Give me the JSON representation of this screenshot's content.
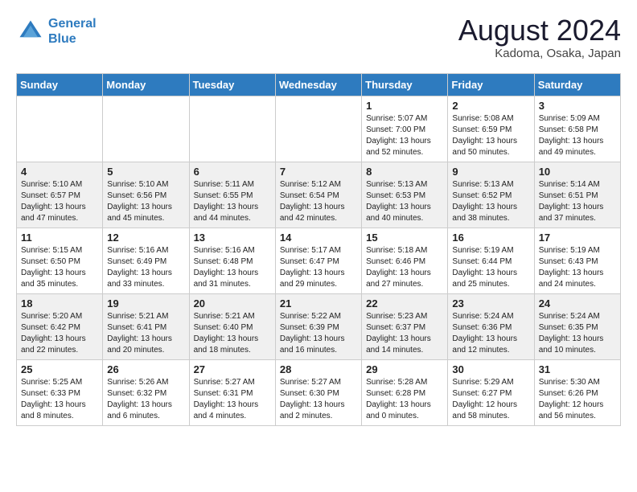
{
  "header": {
    "logo_line1": "General",
    "logo_line2": "Blue",
    "month_title": "August 2024",
    "location": "Kadoma, Osaka, Japan"
  },
  "weekdays": [
    "Sunday",
    "Monday",
    "Tuesday",
    "Wednesday",
    "Thursday",
    "Friday",
    "Saturday"
  ],
  "weeks": [
    [
      {
        "day": "",
        "info": ""
      },
      {
        "day": "",
        "info": ""
      },
      {
        "day": "",
        "info": ""
      },
      {
        "day": "",
        "info": ""
      },
      {
        "day": "1",
        "info": "Sunrise: 5:07 AM\nSunset: 7:00 PM\nDaylight: 13 hours\nand 52 minutes."
      },
      {
        "day": "2",
        "info": "Sunrise: 5:08 AM\nSunset: 6:59 PM\nDaylight: 13 hours\nand 50 minutes."
      },
      {
        "day": "3",
        "info": "Sunrise: 5:09 AM\nSunset: 6:58 PM\nDaylight: 13 hours\nand 49 minutes."
      }
    ],
    [
      {
        "day": "4",
        "info": "Sunrise: 5:10 AM\nSunset: 6:57 PM\nDaylight: 13 hours\nand 47 minutes."
      },
      {
        "day": "5",
        "info": "Sunrise: 5:10 AM\nSunset: 6:56 PM\nDaylight: 13 hours\nand 45 minutes."
      },
      {
        "day": "6",
        "info": "Sunrise: 5:11 AM\nSunset: 6:55 PM\nDaylight: 13 hours\nand 44 minutes."
      },
      {
        "day": "7",
        "info": "Sunrise: 5:12 AM\nSunset: 6:54 PM\nDaylight: 13 hours\nand 42 minutes."
      },
      {
        "day": "8",
        "info": "Sunrise: 5:13 AM\nSunset: 6:53 PM\nDaylight: 13 hours\nand 40 minutes."
      },
      {
        "day": "9",
        "info": "Sunrise: 5:13 AM\nSunset: 6:52 PM\nDaylight: 13 hours\nand 38 minutes."
      },
      {
        "day": "10",
        "info": "Sunrise: 5:14 AM\nSunset: 6:51 PM\nDaylight: 13 hours\nand 37 minutes."
      }
    ],
    [
      {
        "day": "11",
        "info": "Sunrise: 5:15 AM\nSunset: 6:50 PM\nDaylight: 13 hours\nand 35 minutes."
      },
      {
        "day": "12",
        "info": "Sunrise: 5:16 AM\nSunset: 6:49 PM\nDaylight: 13 hours\nand 33 minutes."
      },
      {
        "day": "13",
        "info": "Sunrise: 5:16 AM\nSunset: 6:48 PM\nDaylight: 13 hours\nand 31 minutes."
      },
      {
        "day": "14",
        "info": "Sunrise: 5:17 AM\nSunset: 6:47 PM\nDaylight: 13 hours\nand 29 minutes."
      },
      {
        "day": "15",
        "info": "Sunrise: 5:18 AM\nSunset: 6:46 PM\nDaylight: 13 hours\nand 27 minutes."
      },
      {
        "day": "16",
        "info": "Sunrise: 5:19 AM\nSunset: 6:44 PM\nDaylight: 13 hours\nand 25 minutes."
      },
      {
        "day": "17",
        "info": "Sunrise: 5:19 AM\nSunset: 6:43 PM\nDaylight: 13 hours\nand 24 minutes."
      }
    ],
    [
      {
        "day": "18",
        "info": "Sunrise: 5:20 AM\nSunset: 6:42 PM\nDaylight: 13 hours\nand 22 minutes."
      },
      {
        "day": "19",
        "info": "Sunrise: 5:21 AM\nSunset: 6:41 PM\nDaylight: 13 hours\nand 20 minutes."
      },
      {
        "day": "20",
        "info": "Sunrise: 5:21 AM\nSunset: 6:40 PM\nDaylight: 13 hours\nand 18 minutes."
      },
      {
        "day": "21",
        "info": "Sunrise: 5:22 AM\nSunset: 6:39 PM\nDaylight: 13 hours\nand 16 minutes."
      },
      {
        "day": "22",
        "info": "Sunrise: 5:23 AM\nSunset: 6:37 PM\nDaylight: 13 hours\nand 14 minutes."
      },
      {
        "day": "23",
        "info": "Sunrise: 5:24 AM\nSunset: 6:36 PM\nDaylight: 13 hours\nand 12 minutes."
      },
      {
        "day": "24",
        "info": "Sunrise: 5:24 AM\nSunset: 6:35 PM\nDaylight: 13 hours\nand 10 minutes."
      }
    ],
    [
      {
        "day": "25",
        "info": "Sunrise: 5:25 AM\nSunset: 6:33 PM\nDaylight: 13 hours\nand 8 minutes."
      },
      {
        "day": "26",
        "info": "Sunrise: 5:26 AM\nSunset: 6:32 PM\nDaylight: 13 hours\nand 6 minutes."
      },
      {
        "day": "27",
        "info": "Sunrise: 5:27 AM\nSunset: 6:31 PM\nDaylight: 13 hours\nand 4 minutes."
      },
      {
        "day": "28",
        "info": "Sunrise: 5:27 AM\nSunset: 6:30 PM\nDaylight: 13 hours\nand 2 minutes."
      },
      {
        "day": "29",
        "info": "Sunrise: 5:28 AM\nSunset: 6:28 PM\nDaylight: 13 hours\nand 0 minutes."
      },
      {
        "day": "30",
        "info": "Sunrise: 5:29 AM\nSunset: 6:27 PM\nDaylight: 12 hours\nand 58 minutes."
      },
      {
        "day": "31",
        "info": "Sunrise: 5:30 AM\nSunset: 6:26 PM\nDaylight: 12 hours\nand 56 minutes."
      }
    ]
  ]
}
